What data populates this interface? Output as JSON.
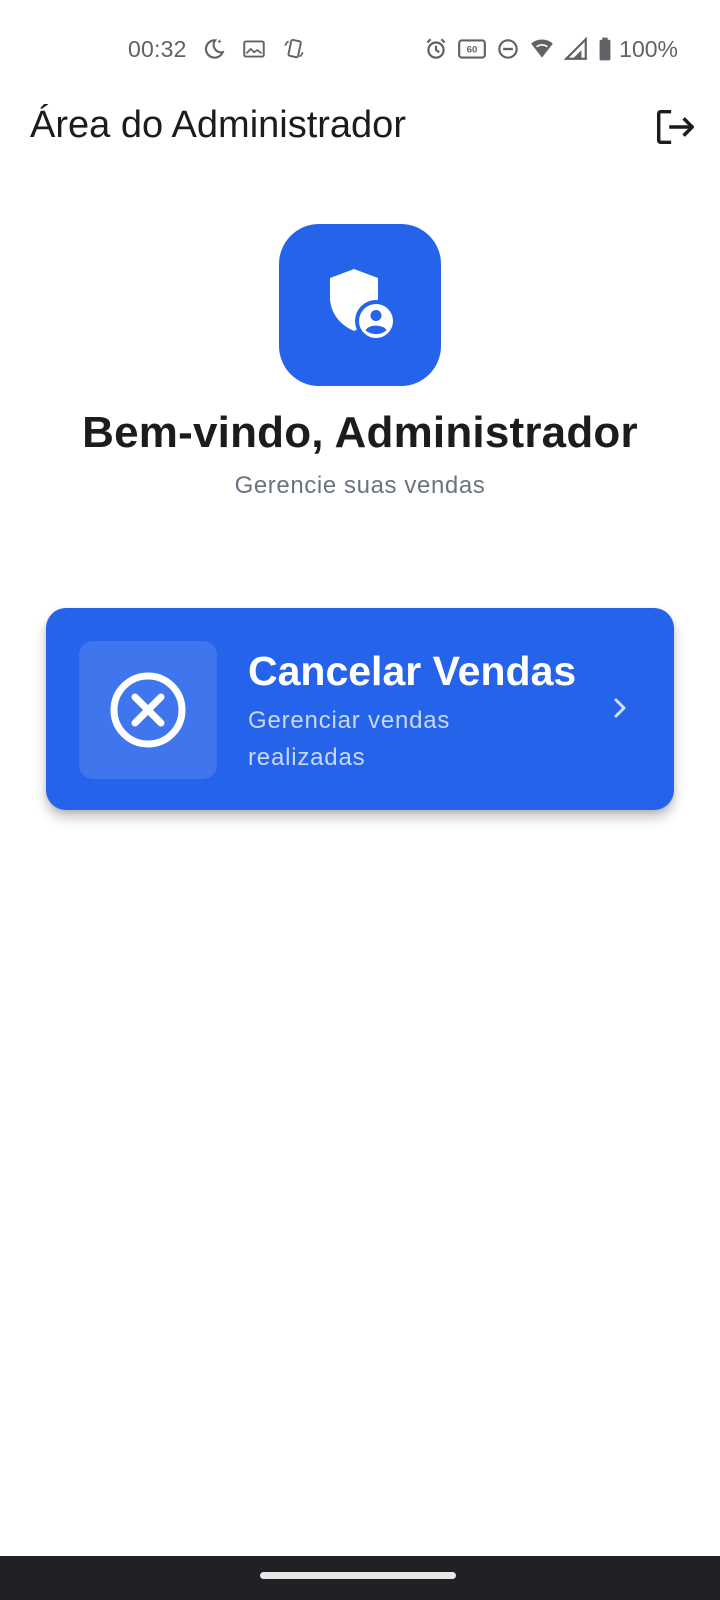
{
  "status_bar": {
    "time": "00:32",
    "battery": "100%",
    "left_icons": [
      "do-not-disturb-moon-icon",
      "gallery-icon",
      "rotate-phone-icon"
    ],
    "right_icons": [
      "alarm-icon",
      "refresh-rate-60hz-icon",
      "dnd-minus-icon",
      "wifi-icon",
      "signal-icon",
      "battery-icon"
    ]
  },
  "app_bar": {
    "title": "Área do Administrador",
    "logout_icon": "logout-icon"
  },
  "hero": {
    "icon": "admin-shield-user-icon",
    "title": "Bem-vindo, Administrador",
    "subtitle": "Gerencie suas vendas"
  },
  "actions": [
    {
      "icon": "cancel-circle-x-icon",
      "title": "Cancelar Vendas",
      "subtitle": "Gerenciar vendas realizadas",
      "chevron_icon": "chevron-right-icon"
    }
  ],
  "colors": {
    "primary": "#2563eb",
    "text": "#1c1c1e",
    "muted": "#6b7280",
    "nav_bar": "#202124"
  }
}
